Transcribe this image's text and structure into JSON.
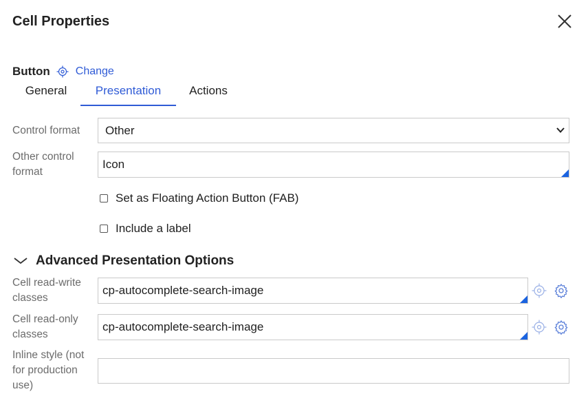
{
  "dialog": {
    "title": "Cell Properties",
    "close_icon": "close-icon"
  },
  "control": {
    "name": "Button",
    "change_label": "Change"
  },
  "tabs": [
    {
      "label": "General",
      "active": false
    },
    {
      "label": "Presentation",
      "active": true
    },
    {
      "label": "Actions",
      "active": false
    }
  ],
  "form": {
    "control_format": {
      "label": "Control format",
      "value": "Other"
    },
    "other_control_format": {
      "label_line1": "Other control",
      "label_line2": "format",
      "value": "Icon"
    },
    "fab_checkbox": {
      "label": "Set as Floating Action Button (FAB)",
      "checked": false
    },
    "include_label_checkbox": {
      "label": "Include a label",
      "checked": false
    }
  },
  "advanced": {
    "title": "Advanced Presentation Options",
    "read_write": {
      "label_line1": "Cell read-write",
      "label_line2": "classes",
      "value": "cp-autocomplete-search-image"
    },
    "read_only": {
      "label_line1": "Cell read-only",
      "label_line2": "classes",
      "value": "cp-autocomplete-search-image"
    },
    "inline_style": {
      "label_line1": "Inline style (not",
      "label_line2": "for production",
      "label_line3": "use)",
      "value": ""
    }
  },
  "colors": {
    "accent": "#2f5bd6",
    "resize_handle": "#1a63e0",
    "label": "#6b6b6b"
  }
}
